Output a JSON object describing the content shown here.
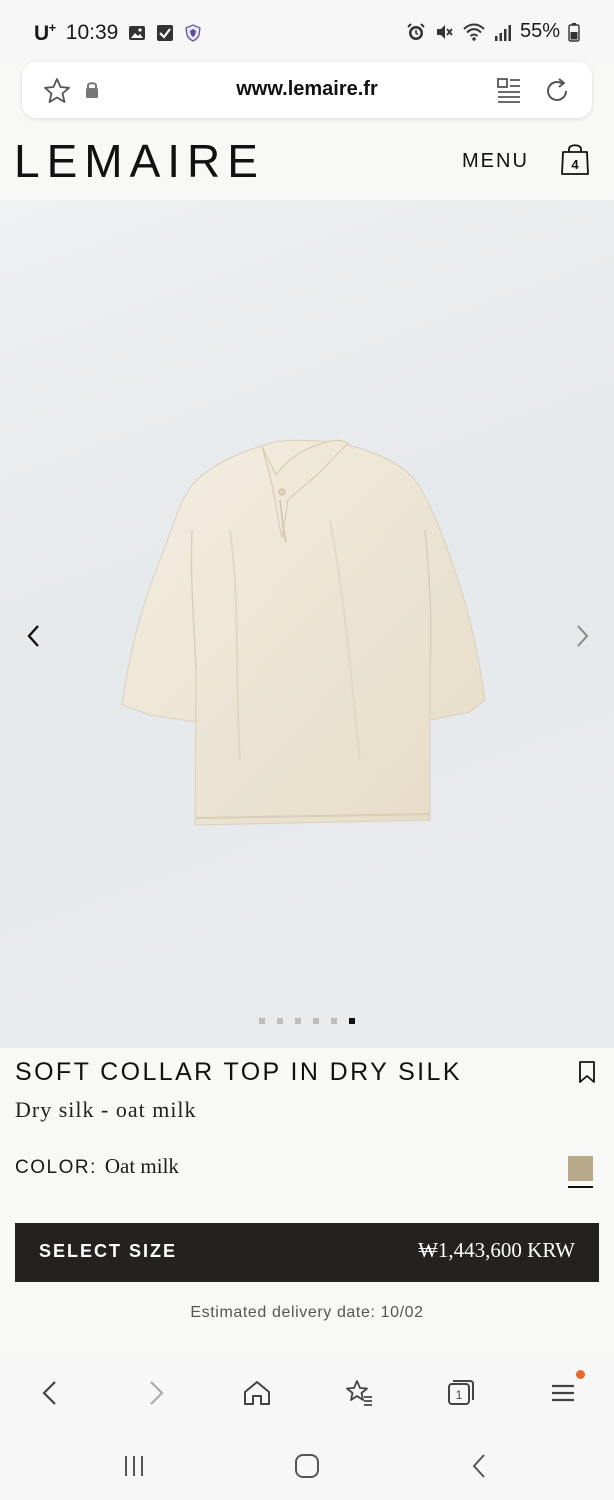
{
  "status_bar": {
    "carrier": "U",
    "carrier_sup": "+",
    "time": "10:39",
    "battery": "55%"
  },
  "url_bar": {
    "url": "www.lemaire.fr"
  },
  "header": {
    "logo": "LEMAIRE",
    "menu_label": "MENU",
    "bag_count": "4"
  },
  "gallery": {
    "image_description_icon": "shirt-image",
    "dot_count": 6,
    "active_dot_index": 5
  },
  "product": {
    "title": "SOFT COLLAR TOP IN DRY SILK",
    "subtitle": "Dry silk - oat milk",
    "color_label": "COLOR:",
    "color_value": "Oat milk",
    "swatch_color": "#b7a98a",
    "select_size_label": "SELECT SIZE",
    "price": "₩1,443,600 KRW",
    "delivery": "Estimated delivery date: 10/02"
  },
  "colors": {
    "accent_dark": "#232221",
    "notification": "#e8692c"
  }
}
